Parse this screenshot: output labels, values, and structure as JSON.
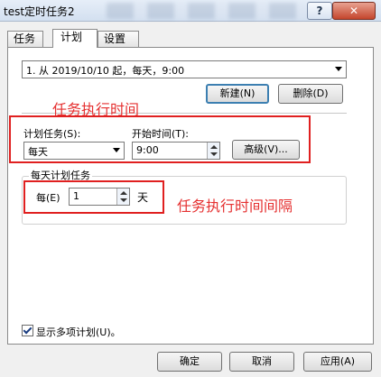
{
  "window": {
    "title": "test定时任务2"
  },
  "tabs": [
    {
      "label": "任务"
    },
    {
      "label": "计划"
    },
    {
      "label": "设置"
    }
  ],
  "schedule": {
    "selected": "1. 从 2019/10/10 起，每天，9:00",
    "new_label": "新建(N)",
    "delete_label": "删除(D)"
  },
  "plan": {
    "task_label": "计划任务(S):",
    "task_value": "每天",
    "start_label": "开始时间(T):",
    "start_value": "9:00",
    "advanced_label": "高级(V)..."
  },
  "daily": {
    "group_title": "每天计划任务",
    "every_label": "每(E)",
    "interval_value": "1",
    "unit_label": "天"
  },
  "annotations": {
    "exec_time": "任务执行时间",
    "interval": "任务执行时间间隔"
  },
  "show_multiple": {
    "label": "显示多项计划(U)。",
    "checked": true
  },
  "footer": {
    "ok_label": "确定",
    "cancel_label": "取消",
    "apply_label": "应用(A)"
  },
  "colors": {
    "annotation": "#e02020",
    "default_button_border": "#3c7fb1",
    "close_button": "#c4452c"
  },
  "icons": {
    "help": "help-icon",
    "close": "close-icon",
    "dropdown": "chevron-down-icon",
    "spin": "spin-arrows-icon",
    "check": "checkmark-icon"
  }
}
